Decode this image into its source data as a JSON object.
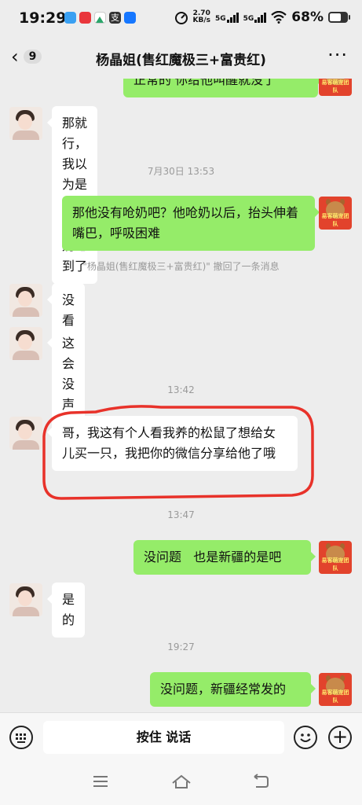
{
  "status_bar": {
    "time": "19:29",
    "net_speed_value": "2.70",
    "net_speed_unit": "KB/s",
    "sig1_label": "5G",
    "sig2_label": "5G",
    "battery": "68%",
    "battery_level": 0.68,
    "app_icons": [
      "cloud-icon",
      "sn-app-icon",
      "mountain-icon",
      "alipay-icon",
      "blue-app-icon"
    ]
  },
  "header": {
    "back_icon": "chevron-left-icon",
    "unread_count": "9",
    "title": "杨晶姐(售红魔极三+富贵红)",
    "more_icon": "more-dots-icon"
  },
  "messages": [
    {
      "type": "out",
      "text": "正常的  你给他叫醒就没了"
    },
    {
      "type": "in",
      "text": "那就行，我以为是我回来喂奶呛到了"
    },
    {
      "type": "time",
      "text": "7月30日 13:53"
    },
    {
      "type": "out",
      "text": "那他没有呛奶吧？他呛奶以后，抬头伸着嘴巴，呼吸困难"
    },
    {
      "type": "system",
      "text": "\"杨晶姐(售红魔极三+富贵红)\" 撤回了一条消息"
    },
    {
      "type": "in",
      "text": "没看到这种动作"
    },
    {
      "type": "in",
      "text": "这会没声了"
    },
    {
      "type": "time",
      "text": "13:42"
    },
    {
      "type": "in",
      "text": "哥，我这有个人看我养的松鼠了想给女儿买一只，我把你的微信分享给他了哦"
    },
    {
      "type": "time",
      "text": "13:47"
    },
    {
      "type": "out",
      "text": "没问题   也是新疆的是吧"
    },
    {
      "type": "in",
      "text": "是的"
    },
    {
      "type": "time",
      "text": "19:27"
    },
    {
      "type": "out",
      "text": "没问题，新疆经常发的"
    }
  ],
  "avatar_caption": "易客萌宠团队",
  "input_bar": {
    "voice_icon": "keyboard-icon",
    "hold_to_talk": "按住 说话",
    "emoji_icon": "emoji-icon",
    "plus_icon": "plus-icon"
  },
  "nav_bar": {
    "menu_icon": "menu-icon",
    "home_icon": "home-icon",
    "back_icon": "back-icon"
  },
  "colors": {
    "out_bubble": "#95ec69",
    "in_bubble": "#ffffff",
    "background": "#ededed",
    "annotation": "#e8322a"
  }
}
